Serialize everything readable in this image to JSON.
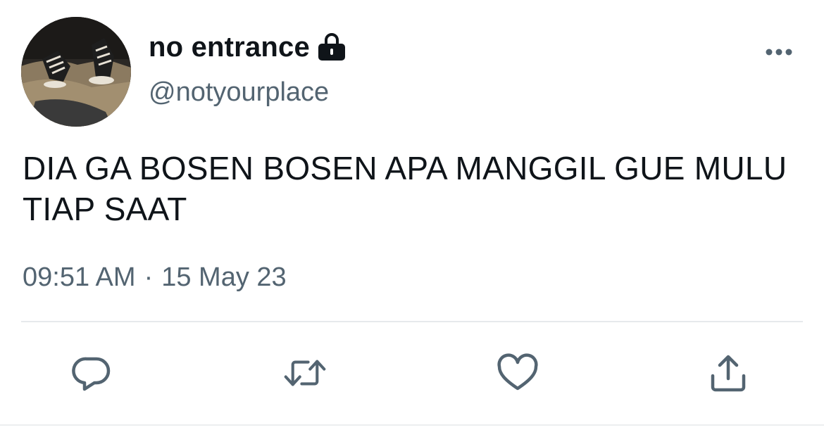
{
  "tweet": {
    "display_name": "no entrance",
    "handle": "@notyourplace",
    "text": "DIA GA BOSEN BOSEN APA MANGGIL GUE MULU TIAP SAAT",
    "time": "09:51 AM",
    "separator": "·",
    "date": "15 May 23"
  },
  "icons": {
    "protected": "lock-icon",
    "more": "more-icon",
    "reply": "reply-icon",
    "retweet": "retweet-icon",
    "like": "heart-icon",
    "share": "share-icon"
  },
  "colors": {
    "text_primary": "#0f1419",
    "text_secondary": "#536471",
    "icon_action": "#536471",
    "divider": "#e6e9ec"
  }
}
